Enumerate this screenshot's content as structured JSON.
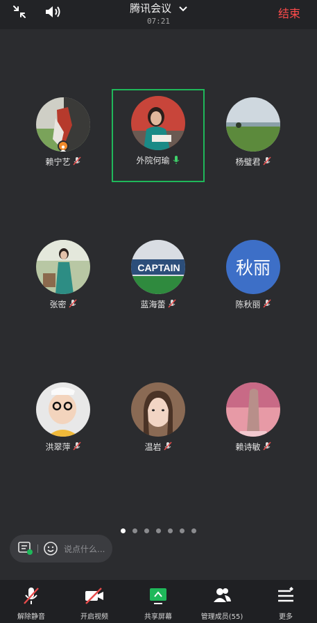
{
  "meeting": {
    "title": "腾讯会议",
    "time": "07:21",
    "end_label": "结束"
  },
  "participants": [
    {
      "name": "赖宁艺"
    },
    {
      "name": "外院何瑜"
    },
    {
      "name": "杨璧君"
    },
    {
      "name": "张密"
    },
    {
      "name": "蓝海蕾"
    },
    {
      "name": "陈秋丽",
      "avatar_text": "秋丽"
    },
    {
      "name": "洪翠萍"
    },
    {
      "name": "温岩"
    },
    {
      "name": "赖诗敏"
    }
  ],
  "avatar_images": {
    "captain_text": "CAPTAIN"
  },
  "pagination": {
    "pages": 7,
    "current": 1
  },
  "chat": {
    "placeholder": "说点什么..."
  },
  "toolbar": [
    {
      "label": "解除静音",
      "icon": "mic-muted-icon"
    },
    {
      "label": "开启视频",
      "icon": "video-off-icon"
    },
    {
      "label": "共享屏幕",
      "icon": "share-screen-icon"
    },
    {
      "label": "管理成员(55)",
      "icon": "members-icon"
    },
    {
      "label": "更多",
      "icon": "more-icon"
    }
  ],
  "colors": {
    "accent_green": "#1fb85a",
    "end_red": "#ff4b4b",
    "avatar_blue": "#3d6fc7",
    "badge_orange": "#f08a2b"
  }
}
